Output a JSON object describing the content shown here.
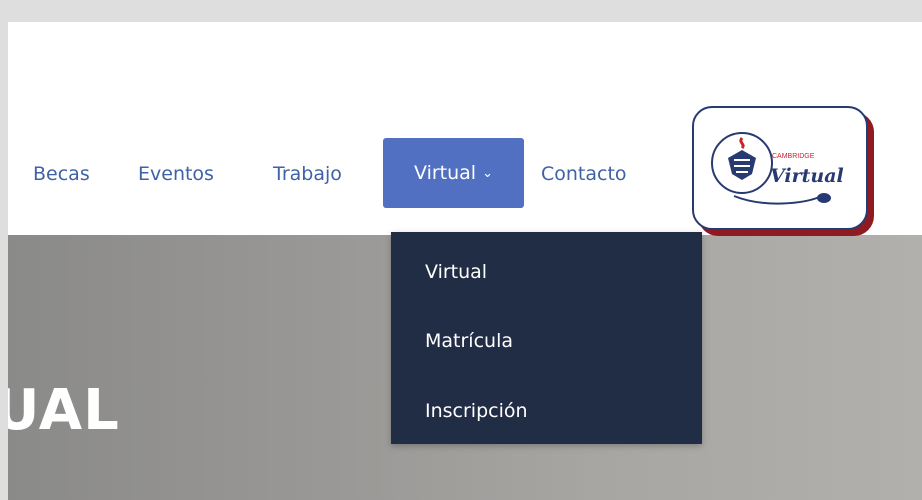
{
  "nav": {
    "items": [
      {
        "label": "Becas"
      },
      {
        "label": "Eventos"
      },
      {
        "label": "Trabajo"
      },
      {
        "label": "Virtual",
        "active": true
      },
      {
        "label": "Contacto"
      }
    ],
    "active_color": "#5270c2",
    "link_color": "#3f62a6",
    "dropdown_icon": "chevron-down-icon"
  },
  "dropdown": {
    "background": "#212c45",
    "items": [
      {
        "label": "Virtual"
      },
      {
        "label": "Matrícula"
      },
      {
        "label": "Inscripción"
      }
    ]
  },
  "logo": {
    "text_top": "CAMBRIDGE",
    "text_main": "Virtual",
    "icon": "shield-crest-icon",
    "mouse_icon": "computer-mouse-icon"
  },
  "hero": {
    "title": "UAL"
  }
}
